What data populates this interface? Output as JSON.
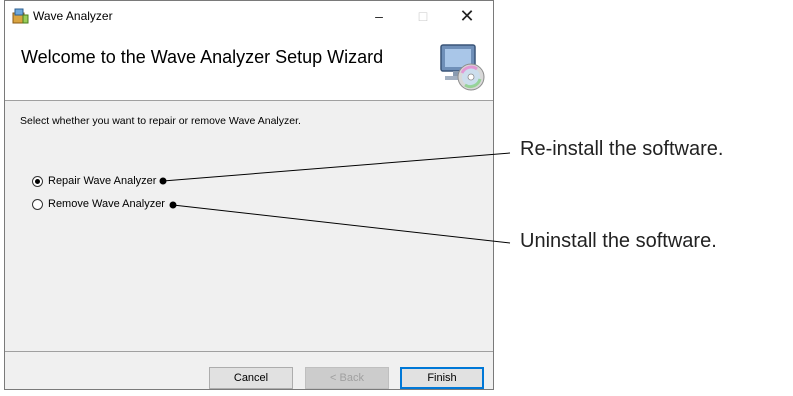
{
  "window": {
    "title": "Wave Analyzer",
    "icon": "installer-icon",
    "controls": {
      "minimize": "–",
      "maximize": "□",
      "close": "✕"
    }
  },
  "banner": {
    "title": "Welcome to the Wave Analyzer Setup Wizard",
    "graphic": "computer-cd-icon"
  },
  "content": {
    "instruction": "Select whether you want to repair or remove Wave Analyzer.",
    "options": [
      {
        "label": "Repair Wave Analyzer",
        "checked": true
      },
      {
        "label": "Remove Wave Analyzer",
        "checked": false
      }
    ]
  },
  "footer": {
    "cancel_label": "Cancel",
    "back_label": "< Back",
    "finish_label": "Finish"
  },
  "annotations": {
    "repair": "Re-install the software.",
    "remove": "Uninstall the software."
  }
}
